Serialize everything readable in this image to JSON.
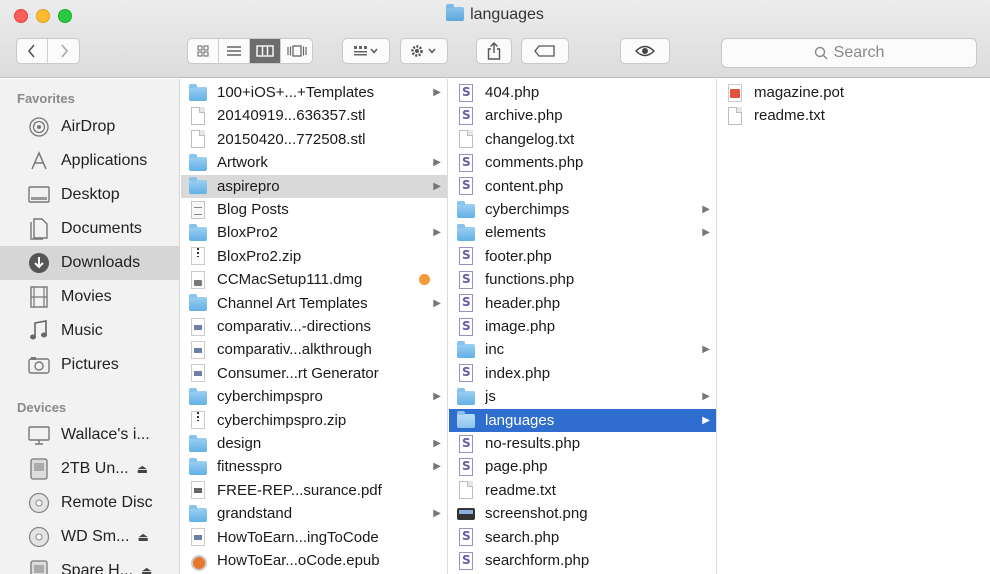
{
  "window": {
    "title": "languages",
    "title_icon": "folder-icon"
  },
  "toolbar": {
    "back_icon": "chevron-left-icon",
    "forward_icon": "chevron-right-icon",
    "view_modes": [
      "icon-view",
      "list-view",
      "column-view",
      "cover-flow-view"
    ],
    "active_view": "column-view",
    "arrange_icon": "arrange-grid-icon",
    "action_icon": "gear-icon",
    "share_icon": "share-icon",
    "tags_icon": "tag-icon",
    "quicklook_icon": "eye-icon",
    "search_placeholder": "Search"
  },
  "sidebar": {
    "favorites_label": "Favorites",
    "favorites": [
      {
        "label": "AirDrop",
        "icon": "airdrop-icon"
      },
      {
        "label": "Applications",
        "icon": "applications-icon"
      },
      {
        "label": "Desktop",
        "icon": "desktop-icon"
      },
      {
        "label": "Documents",
        "icon": "documents-icon"
      },
      {
        "label": "Downloads",
        "icon": "downloads-icon",
        "selected": true
      },
      {
        "label": "Movies",
        "icon": "movies-icon"
      },
      {
        "label": "Music",
        "icon": "music-icon"
      },
      {
        "label": "Pictures",
        "icon": "pictures-icon"
      }
    ],
    "devices_label": "Devices",
    "devices": [
      {
        "label": "Wallace's i...",
        "icon": "computer-icon"
      },
      {
        "label": "2TB Un...",
        "icon": "drive-icon",
        "eject": "⏏"
      },
      {
        "label": "Remote Disc",
        "icon": "disc-icon"
      },
      {
        "label": "WD Sm...",
        "icon": "disk-icon",
        "eject": "⏏"
      },
      {
        "label": "Spare H...",
        "icon": "drive-icon",
        "eject": "⏏"
      }
    ]
  },
  "columns": [
    {
      "items": [
        {
          "name": "100+iOS+...+Templates",
          "kind": "folder",
          "arrow": true
        },
        {
          "name": "20140919...636357.stl",
          "kind": "doc"
        },
        {
          "name": "20150420...772508.stl",
          "kind": "doc"
        },
        {
          "name": "Artwork",
          "kind": "folder",
          "arrow": true
        },
        {
          "name": "aspirepro",
          "kind": "folder",
          "arrow": true,
          "selected": "gray"
        },
        {
          "name": "Blog Posts",
          "kind": "text"
        },
        {
          "name": "BloxPro2",
          "kind": "folder",
          "arrow": true
        },
        {
          "name": "BloxPro2.zip",
          "kind": "zip"
        },
        {
          "name": "CCMacSetup111.dmg",
          "kind": "dmg",
          "tag_color": "#f59a3a"
        },
        {
          "name": "Channel Art Templates",
          "kind": "folder",
          "arrow": true
        },
        {
          "name": "comparativ...-directions",
          "kind": "page"
        },
        {
          "name": "comparativ...alkthrough",
          "kind": "page"
        },
        {
          "name": "Consumer...rt Generator",
          "kind": "page"
        },
        {
          "name": "cyberchimpspro",
          "kind": "folder",
          "arrow": true
        },
        {
          "name": "cyberchimpspro.zip",
          "kind": "zip"
        },
        {
          "name": "design",
          "kind": "folder",
          "arrow": true
        },
        {
          "name": "fitnesspro",
          "kind": "folder",
          "arrow": true
        },
        {
          "name": "FREE-REP...surance.pdf",
          "kind": "pdf"
        },
        {
          "name": "grandstand",
          "kind": "folder",
          "arrow": true
        },
        {
          "name": "HowToEarn...ingToCode",
          "kind": "page"
        },
        {
          "name": "HowToEar...oCode.epub",
          "kind": "epub"
        }
      ]
    },
    {
      "items": [
        {
          "name": "404.php",
          "kind": "php"
        },
        {
          "name": "archive.php",
          "kind": "php"
        },
        {
          "name": "changelog.txt",
          "kind": "doc"
        },
        {
          "name": "comments.php",
          "kind": "php"
        },
        {
          "name": "content.php",
          "kind": "php"
        },
        {
          "name": "cyberchimps",
          "kind": "folder",
          "arrow": true
        },
        {
          "name": "elements",
          "kind": "folder",
          "arrow": true
        },
        {
          "name": "footer.php",
          "kind": "php"
        },
        {
          "name": "functions.php",
          "kind": "php"
        },
        {
          "name": "header.php",
          "kind": "php"
        },
        {
          "name": "image.php",
          "kind": "php"
        },
        {
          "name": "inc",
          "kind": "folder",
          "arrow": true
        },
        {
          "name": "index.php",
          "kind": "php"
        },
        {
          "name": "js",
          "kind": "folder",
          "arrow": true
        },
        {
          "name": "languages",
          "kind": "folder",
          "arrow": true,
          "selected": "blue"
        },
        {
          "name": "no-results.php",
          "kind": "php"
        },
        {
          "name": "page.php",
          "kind": "php"
        },
        {
          "name": "readme.txt",
          "kind": "doc"
        },
        {
          "name": "screenshot.png",
          "kind": "png"
        },
        {
          "name": "search.php",
          "kind": "php"
        },
        {
          "name": "searchform.php",
          "kind": "php"
        }
      ]
    },
    {
      "items": [
        {
          "name": "magazine.pot",
          "kind": "pot"
        },
        {
          "name": "readme.txt",
          "kind": "doc"
        }
      ]
    }
  ]
}
